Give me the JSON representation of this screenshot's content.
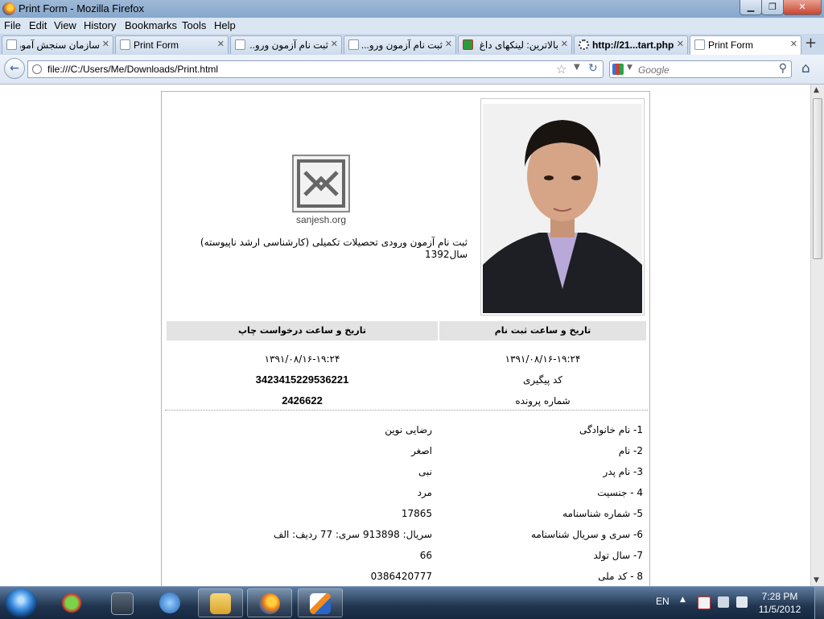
{
  "window": {
    "title": "Print Form - Mozilla Firefox",
    "minimize": "▁",
    "maximize": "❐",
    "close": "✕"
  },
  "menu": [
    "File",
    "Edit",
    "View",
    "History",
    "Bookmarks",
    "Tools",
    "Help"
  ],
  "tabs": [
    {
      "label": "سازمان سنجش آموز..."
    },
    {
      "label": "Print Form"
    },
    {
      "label": "ثبت نام آزمون ورو..."
    },
    {
      "label": "ثبت نام آزمون ورو..."
    },
    {
      "label": "بالاترین: لینکهای داغ"
    },
    {
      "label": "http://21...tart.php"
    },
    {
      "label": "Print Form"
    }
  ],
  "nav": {
    "url": "file:///C:/Users/Me/Downloads/Print.html",
    "search_placeholder": "Google"
  },
  "form": {
    "logo_text": "sanjesh.org",
    "exam_title": "ثبت نام آزمون ورودی تحصیلات تکمیلی (کارشناسی ارشد ناپیوسته) سال1392",
    "headers": {
      "registration": "تاریخ و ساعت ثبت نام",
      "print_request": "تاریخ و ساعت درخواست چاپ"
    },
    "registration_datetime": "۱۳۹۱/۰۸/۱۶-۱۹:۲۴",
    "print_datetime": "۱۳۹۱/۰۸/۱۶-۱۹:۲۴",
    "tracking_label": "کد پیگیری",
    "tracking_code": "3423415229536221",
    "file_label": "شماره پرونده",
    "file_number": "2426622",
    "rows": [
      {
        "label": "1- نام خانوادگی",
        "value": "رضایی نوین"
      },
      {
        "label": "2- نام",
        "value": "اصغر"
      },
      {
        "label": "3- نام پدر",
        "value": "نبی"
      },
      {
        "label": "4 - جنسیت",
        "value": "مرد"
      },
      {
        "label": "5- شماره شناسنامه",
        "value": "17865"
      },
      {
        "label": "6- سری و سریال شناسنامه",
        "value": "سریال: 913898  سری: 77  ردیف: الف"
      },
      {
        "label": "7- سال تولد",
        "value": "66"
      },
      {
        "label": "8 - کد ملی",
        "value": "0386420777"
      }
    ]
  },
  "taskbar": {
    "language": "EN",
    "time": "7:28 PM",
    "date": "11/5/2012",
    "tray_up": "▲"
  },
  "colors": {
    "titlebar": "#9fb9d6",
    "taskbar": "#20344f",
    "header_bg": "#e3e3e3"
  }
}
